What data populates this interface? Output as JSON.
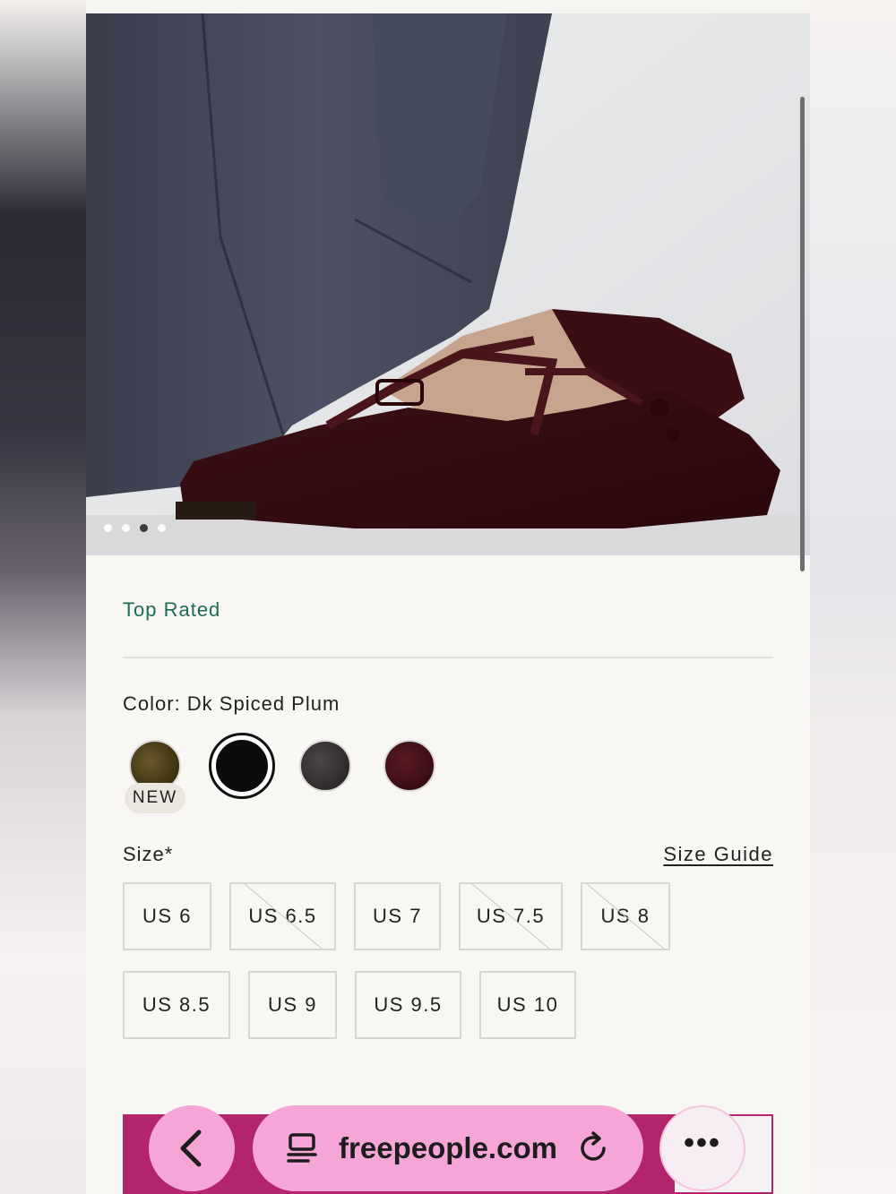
{
  "product": {
    "badge": "Top Rated",
    "color_label": "Color: Dk Spiced Plum",
    "swatches": [
      {
        "name": "olive-brown",
        "color": "#5a4a20",
        "tag": "NEW"
      },
      {
        "name": "black",
        "color": "#0c0c0d",
        "selected": true
      },
      {
        "name": "charcoal",
        "color": "#3e383a"
      },
      {
        "name": "dk-spiced-plum",
        "color": "#4a1219"
      }
    ],
    "size_label": "Size*",
    "size_guide": "Size Guide",
    "sizes": [
      {
        "label": "US 6",
        "available": true
      },
      {
        "label": "US 6.5",
        "available": false
      },
      {
        "label": "US 7",
        "available": true
      },
      {
        "label": "US 7.5",
        "available": false
      },
      {
        "label": "US 8",
        "available": false
      },
      {
        "label": "US 8.5",
        "available": true
      },
      {
        "label": "US 9",
        "available": true
      },
      {
        "label": "US 9.5",
        "available": true
      },
      {
        "label": "US 10",
        "available": true
      }
    ]
  },
  "gallery": {
    "image_count": 4,
    "active_index": 2
  },
  "browser": {
    "url": "freepeople.com",
    "accent": "#f6a6d6"
  },
  "colors": {
    "accent_green": "#1e6b56",
    "cta_pink": "#b3266c"
  }
}
